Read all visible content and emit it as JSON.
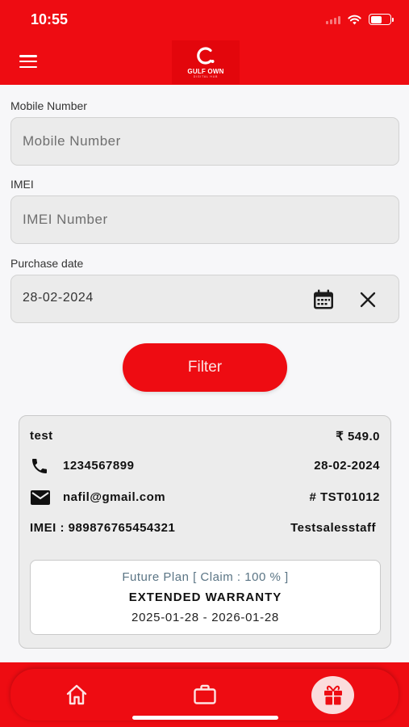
{
  "status_bar": {
    "time": "10:55"
  },
  "header": {
    "logo_name": "GULF OWN",
    "logo_sub": "DIGITAL HUB"
  },
  "form": {
    "mobile": {
      "label": "Mobile Number",
      "placeholder": "Mobile Number",
      "value": ""
    },
    "imei": {
      "label": "IMEI",
      "placeholder": "IMEI Number",
      "value": ""
    },
    "purchase_date": {
      "label": "Purchase date",
      "value": "28-02-2024"
    },
    "filter_label": "Filter"
  },
  "result_card": {
    "name": "test",
    "amount": "₹ 549.0",
    "phone": "1234567899",
    "date": "28-02-2024",
    "email": "nafil@gmail.com",
    "reference": "# TST01012",
    "imei": "IMEI : 989876765454321",
    "staff": "Testsalesstaff",
    "plan": {
      "name": "Future Plan  [ Claim : 100 % ]",
      "type": "EXTENDED WARRANTY",
      "dates": "2025-01-28  -  2026-01-28"
    }
  },
  "bottom_nav": {
    "items": [
      {
        "icon": "home-icon",
        "active": false
      },
      {
        "icon": "briefcase-icon",
        "active": false
      },
      {
        "icon": "gift-icon",
        "active": true
      }
    ]
  },
  "colors": {
    "brand_red": "#ee0c12",
    "active_tab_bg": "#fbdcdc",
    "plan_name": "#5b7585"
  }
}
